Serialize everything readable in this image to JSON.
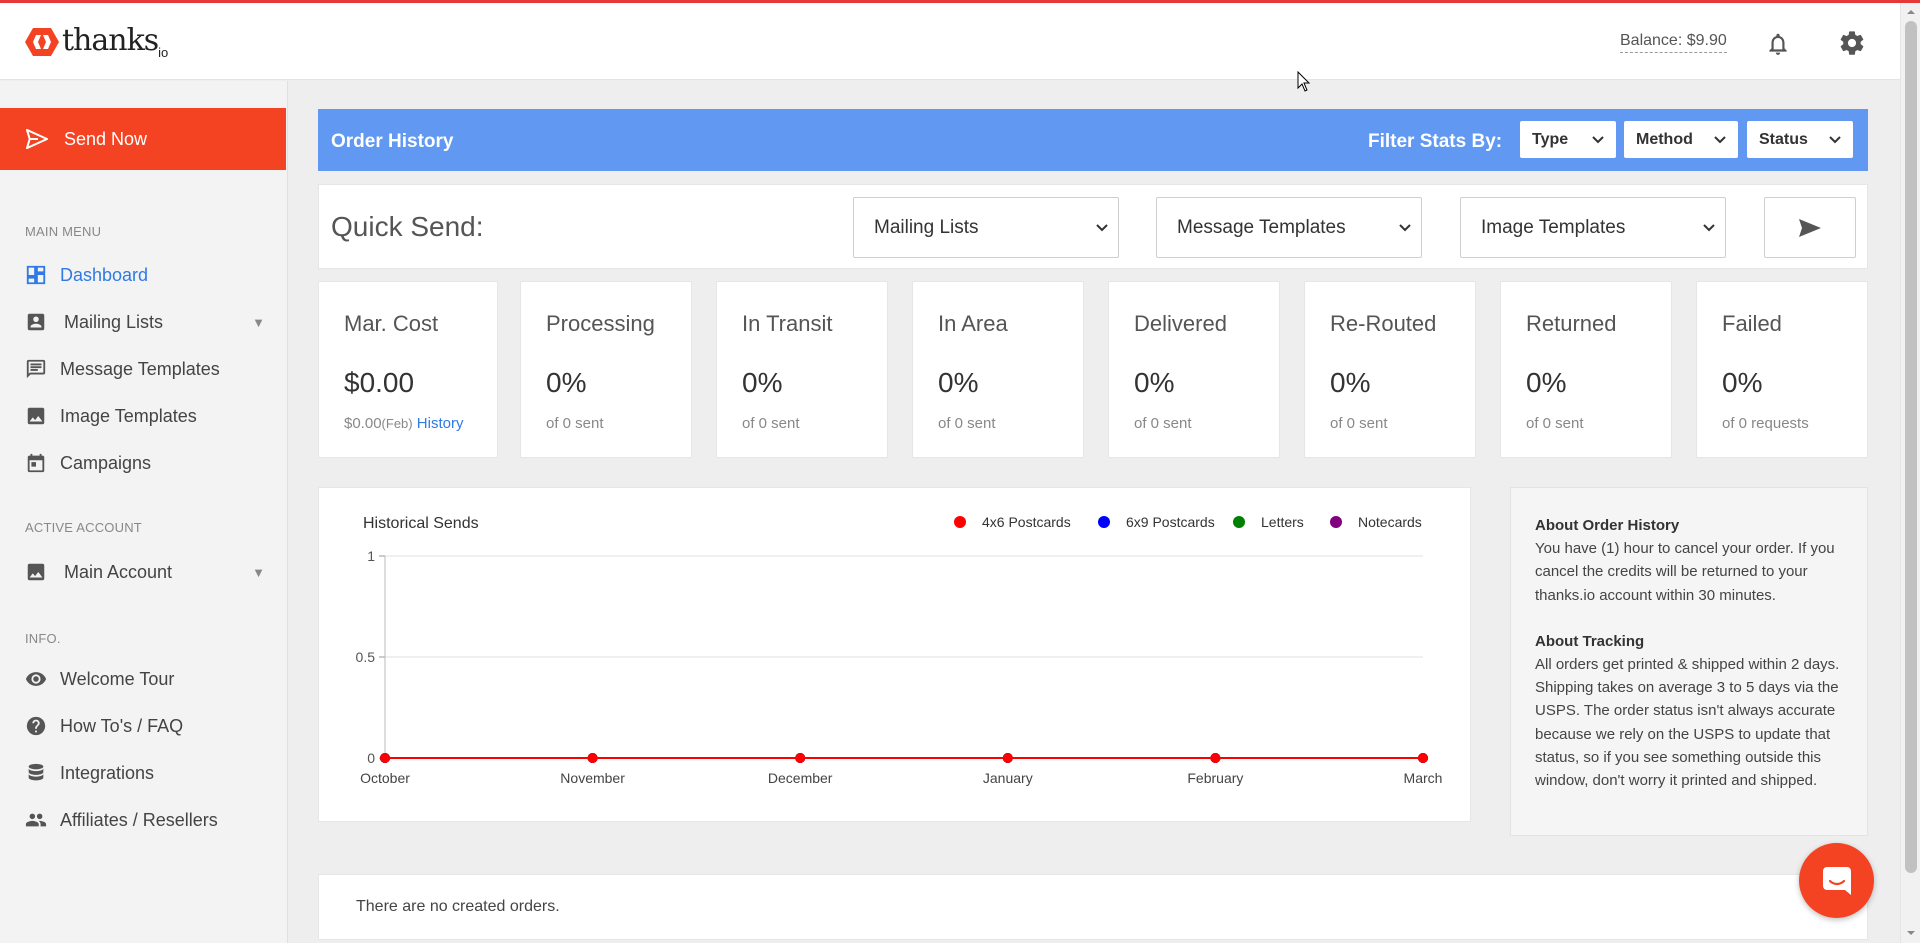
{
  "header": {
    "logo_text": "thanks",
    "logo_suffix": "io",
    "balance": "Balance: $9.90"
  },
  "sidebar": {
    "send_now": "Send Now",
    "sections": {
      "main_menu": "MAIN MENU",
      "active_account": "ACTIVE ACCOUNT",
      "info": "INFO."
    },
    "main_menu": [
      {
        "label": "Dashboard",
        "icon": "dashboard-icon",
        "active": true
      },
      {
        "label": "Mailing Lists",
        "icon": "contacts-icon",
        "expandable": true
      },
      {
        "label": "Message Templates",
        "icon": "message-icon"
      },
      {
        "label": "Image Templates",
        "icon": "image-icon"
      },
      {
        "label": "Campaigns",
        "icon": "calendar-icon"
      }
    ],
    "account": {
      "label": "Main Account",
      "icon": "image-icon"
    },
    "info": [
      {
        "label": "Welcome Tour",
        "icon": "eye-icon"
      },
      {
        "label": "How To's / FAQ",
        "icon": "help-icon"
      },
      {
        "label": "Integrations",
        "icon": "database-icon"
      },
      {
        "label": "Affiliates / Resellers",
        "icon": "people-icon"
      }
    ]
  },
  "order_history": {
    "title": "Order History",
    "filter_label": "Filter Stats By:",
    "filters": [
      "Type",
      "Method",
      "Status"
    ]
  },
  "quick_send": {
    "label": "Quick Send:",
    "selects": [
      "Mailing Lists",
      "Message Templates",
      "Image Templates"
    ]
  },
  "stats": [
    {
      "title": "Mar. Cost",
      "value": "$0.00",
      "sub": "$0.00",
      "sub_small": "(Feb)",
      "sub_link": "History"
    },
    {
      "title": "Processing",
      "value": "0%",
      "sub": "of 0 sent"
    },
    {
      "title": "In Transit",
      "value": "0%",
      "sub": "of 0 sent"
    },
    {
      "title": "In Area",
      "value": "0%",
      "sub": "of 0 sent"
    },
    {
      "title": "Delivered",
      "value": "0%",
      "sub": "of 0 sent"
    },
    {
      "title": "Re-Routed",
      "value": "0%",
      "sub": "of 0 sent"
    },
    {
      "title": "Returned",
      "value": "0%",
      "sub": "of 0 sent"
    },
    {
      "title": "Failed",
      "value": "0%",
      "sub": "of 0 requests"
    }
  ],
  "chart_data": {
    "type": "line",
    "title": "Historical Sends",
    "categories": [
      "October",
      "November",
      "December",
      "January",
      "February",
      "March"
    ],
    "series": [
      {
        "name": "4x6 Postcards",
        "color": "#ff0000",
        "values": [
          0,
          0,
          0,
          0,
          0,
          0
        ]
      },
      {
        "name": "6x9 Postcards",
        "color": "#0000ff",
        "values": [
          0,
          0,
          0,
          0,
          0,
          0
        ]
      },
      {
        "name": "Letters",
        "color": "#008000",
        "values": [
          0,
          0,
          0,
          0,
          0,
          0
        ]
      },
      {
        "name": "Notecards",
        "color": "#800080",
        "values": [
          0,
          0,
          0,
          0,
          0,
          0
        ]
      }
    ],
    "yticks": [
      "1",
      "0.5",
      "0"
    ],
    "ylim": [
      0,
      1
    ],
    "legend": "top-right",
    "grid": true
  },
  "about": {
    "order_history_title": "About Order History",
    "order_history_text": "You have (1) hour to cancel your order. If you cancel the credits will be returned to your thanks.io account within 30 minutes.",
    "tracking_title": "About Tracking",
    "tracking_text": "All orders get printed & shipped within 2 days. Shipping takes on average 3 to 5 days via the USPS. The order status isn't always accurate because we rely on the USPS to update that status, so if you see something outside this window, don't worry it printed and shipped."
  },
  "orders": {
    "empty_text": "There are no created orders."
  },
  "colors": {
    "accent": "#f44323",
    "header_bar": "#6098f2",
    "link": "#2f7ae5"
  }
}
